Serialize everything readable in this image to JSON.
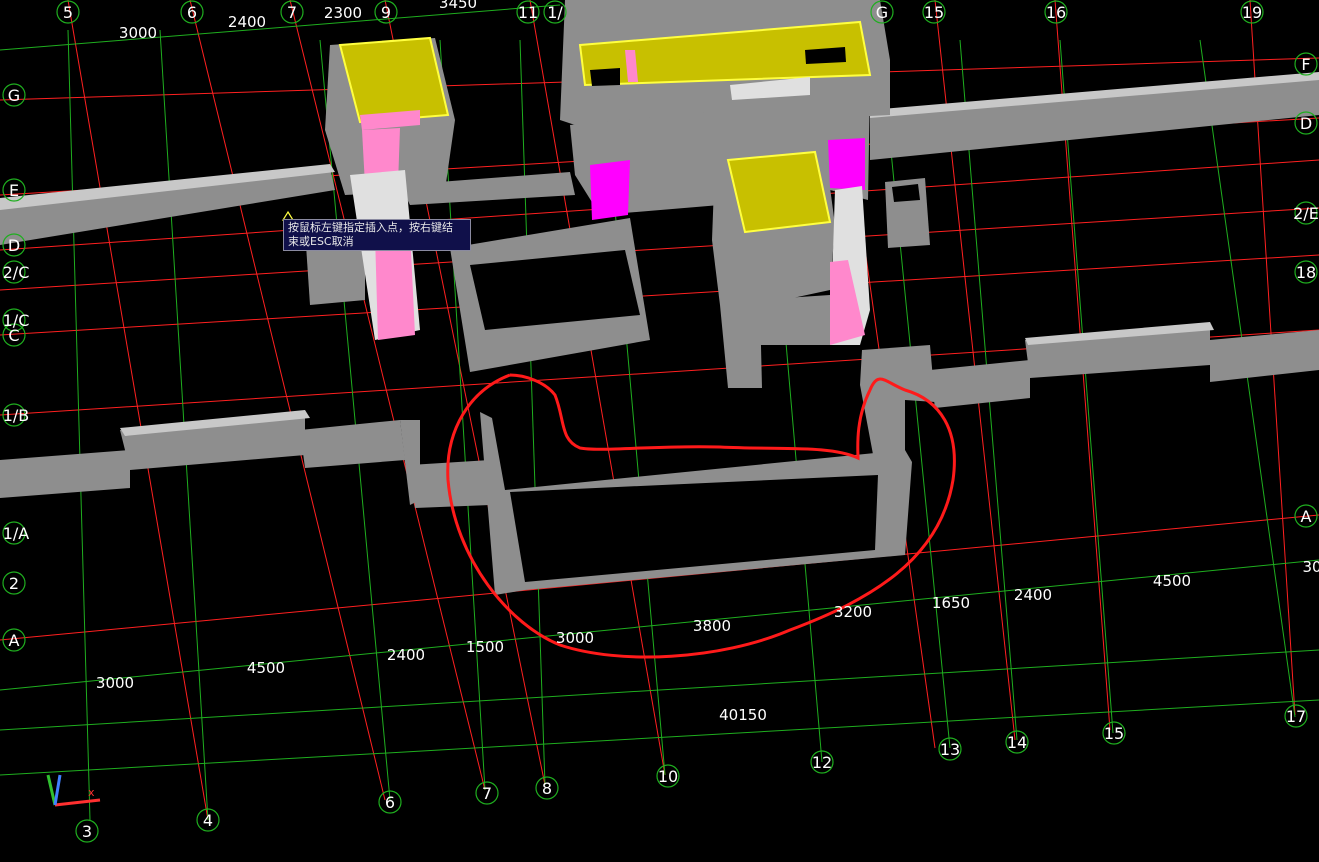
{
  "app": {
    "tooltip": {
      "line1": "按鼠标左键指定插入点，按右键结",
      "line2": "束或ESC取消"
    }
  },
  "colors": {
    "background": "#000000",
    "axis_line": "#ff2020",
    "dim_line": "#1fae1f",
    "wall_top": "#c8c8c8",
    "wall_face": "#8e8e8e",
    "slab_yellow": "#c8c000",
    "magenta": "#ff00ff",
    "pink": "#ff88cc",
    "annotation": "#ff1a1a",
    "ucs_x": "#ff3030",
    "ucs_y": "#30c030",
    "ucs_z": "#4080ff"
  },
  "axis_bubbles_top": [
    "5",
    "6",
    "7",
    "9",
    "11",
    "1/",
    "G",
    "15",
    "16",
    "19"
  ],
  "axis_bubbles_left": [
    "G",
    "E",
    "D",
    "2/C",
    "1/C",
    "C",
    "1/B",
    "1/A",
    "2",
    "A"
  ],
  "axis_bubbles_right": [
    "F",
    "D",
    "2/E",
    "18",
    "A"
  ],
  "axis_bubbles_bottom": [
    "3",
    "4",
    "6",
    "7",
    "8",
    "10",
    "12",
    "13",
    "14",
    "15",
    "17"
  ],
  "dimensions_top": [
    "3000",
    "2400",
    "2300",
    "3450"
  ],
  "dimensions_row1": [
    "1500",
    "3000",
    "3800",
    "3200",
    "1650",
    "2400",
    "4500",
    "30"
  ],
  "dimensions_row2": [
    "3000",
    "4500",
    "2400"
  ],
  "dimension_total": "40150",
  "ucs": {
    "x_label": "x"
  }
}
